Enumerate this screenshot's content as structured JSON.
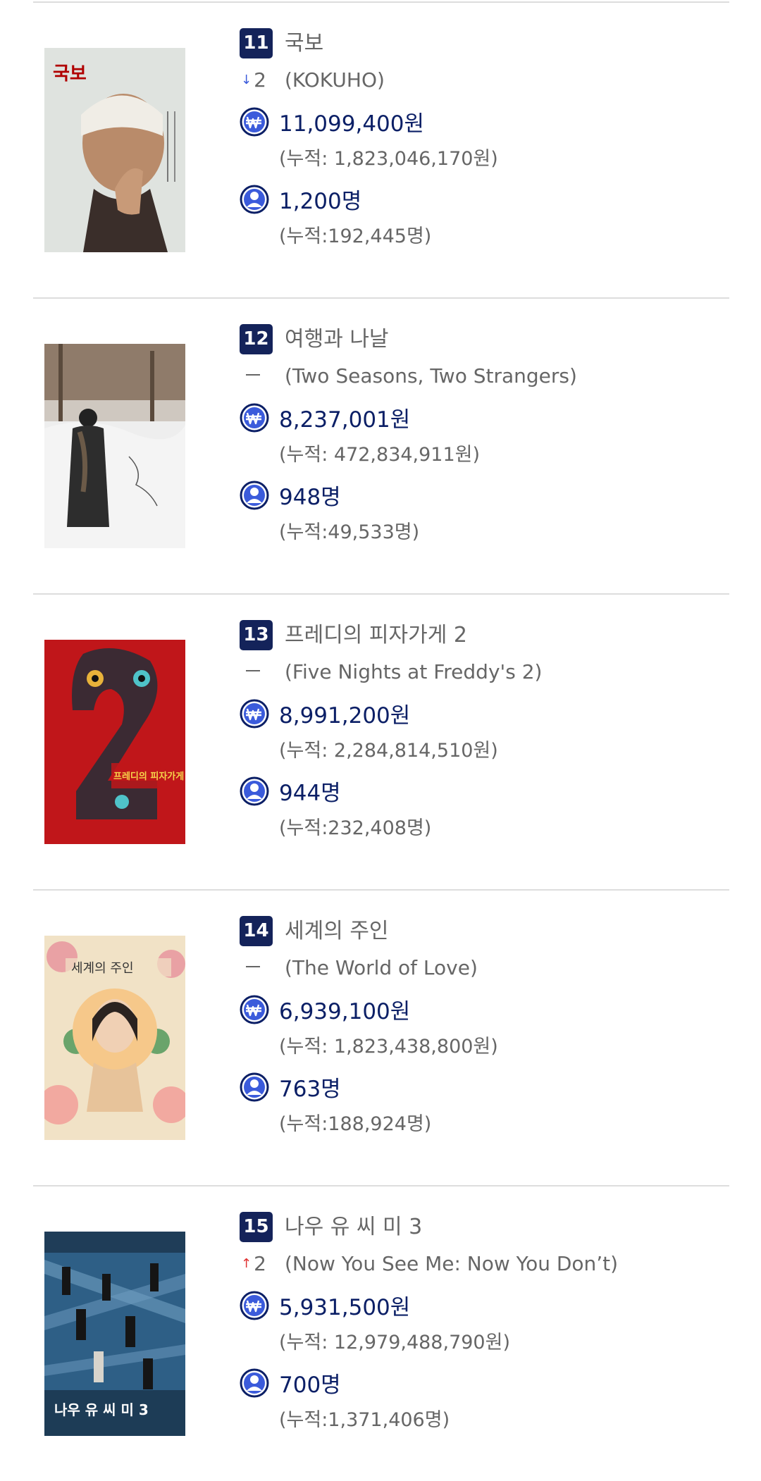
{
  "colors": {
    "rank_badge": "#14235a",
    "value_text": "#0b1f66",
    "meta_text": "#666666",
    "icon_accent": "#3b5bdb",
    "arrow_down": "#3b5bdb",
    "arrow_up": "#e03131",
    "divider": "#dddddd"
  },
  "icons": {
    "revenue": "won-circle-icon",
    "audience": "person-circle-icon",
    "rank_down": "arrow-down-icon",
    "rank_up": "arrow-up-icon",
    "rank_same": "dash-icon"
  },
  "movies": [
    {
      "rank": "11",
      "title": "국보",
      "change_dir": "down",
      "change_value": "2",
      "original_title": "(KOKUHO)",
      "daily_revenue": "11,099,400원",
      "cumulative_revenue": "(누적: 1,823,046,170원)",
      "daily_audience": "1,200명",
      "cumulative_audience": "(누적:192,445명)",
      "poster_text": "국보"
    },
    {
      "rank": "12",
      "title": "여행과 나날",
      "change_dir": "same",
      "change_value": "",
      "original_title": "(Two Seasons, Two Strangers)",
      "daily_revenue": "8,237,001원",
      "cumulative_revenue": "(누적: 472,834,911원)",
      "daily_audience": "948명",
      "cumulative_audience": "(누적:49,533명)",
      "poster_text": ""
    },
    {
      "rank": "13",
      "title": "프레디의 피자가게 2",
      "change_dir": "same",
      "change_value": "",
      "original_title": "(Five Nights at Freddy's 2)",
      "daily_revenue": "8,991,200원",
      "cumulative_revenue": "(누적: 2,284,814,510원)",
      "daily_audience": "944명",
      "cumulative_audience": "(누적:232,408명)",
      "poster_text": "프레디의 피자가게"
    },
    {
      "rank": "14",
      "title": "세계의 주인",
      "change_dir": "same",
      "change_value": "",
      "original_title": "(The World of Love)",
      "daily_revenue": "6,939,100원",
      "cumulative_revenue": "(누적: 1,823,438,800원)",
      "daily_audience": "763명",
      "cumulative_audience": "(누적:188,924명)",
      "poster_text": "세계의 주인"
    },
    {
      "rank": "15",
      "title": "나우 유 씨 미 3",
      "change_dir": "up",
      "change_value": "2",
      "original_title": "(Now You See Me: Now You Don’t)",
      "daily_revenue": "5,931,500원",
      "cumulative_revenue": "(누적: 12,979,488,790원)",
      "daily_audience": "700명",
      "cumulative_audience": "(누적:1,371,406명)",
      "poster_text": "나우 유 씨 미 3"
    }
  ]
}
